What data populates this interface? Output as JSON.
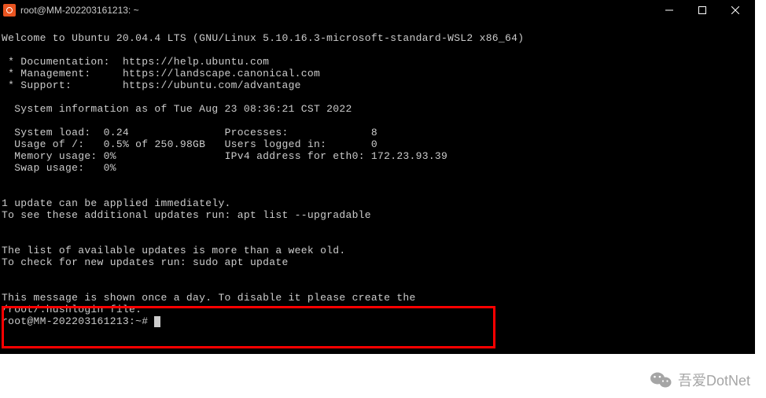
{
  "titlebar": {
    "title": "root@MM-202203161213: ~"
  },
  "motd": {
    "welcome": "Welcome to Ubuntu 20.04.4 LTS (GNU/Linux 5.10.16.3-microsoft-standard-WSL2 x86_64)",
    "links": {
      "doc_label": " * Documentation:",
      "doc_url": "https://help.ubuntu.com",
      "mgmt_label": " * Management:",
      "mgmt_url": "https://landscape.canonical.com",
      "sup_label": " * Support:",
      "sup_url": "https://ubuntu.com/advantage"
    },
    "sysinfo_header": "  System information as of Tue Aug 23 08:36:21 CST 2022",
    "stats": {
      "system_load_label": "  System load:",
      "system_load": "0.24",
      "processes_label": "Processes:",
      "processes": "8",
      "usage_label": "  Usage of /:",
      "usage": "0.5% of 250.98GB",
      "users_label": "Users logged in:",
      "users": "0",
      "memory_label": "  Memory usage:",
      "memory": "0%",
      "ipv4_label": "IPv4 address for eth0:",
      "ipv4": "172.23.93.39",
      "swap_label": "  Swap usage:",
      "swap": "0%"
    },
    "updates_line1": "1 update can be applied immediately.",
    "updates_line2": "To see these additional updates run: apt list --upgradable",
    "stale_line1": "The list of available updates is more than a week old.",
    "stale_line2": "To check for new updates run: sudo apt update",
    "hush_line1": "This message is shown once a day. To disable it please create the",
    "hush_line2": "/root/.hushlogin file."
  },
  "prompt": {
    "text": "root@MM-202203161213:~# "
  },
  "watermark": {
    "text": "吾爱DotNet"
  }
}
